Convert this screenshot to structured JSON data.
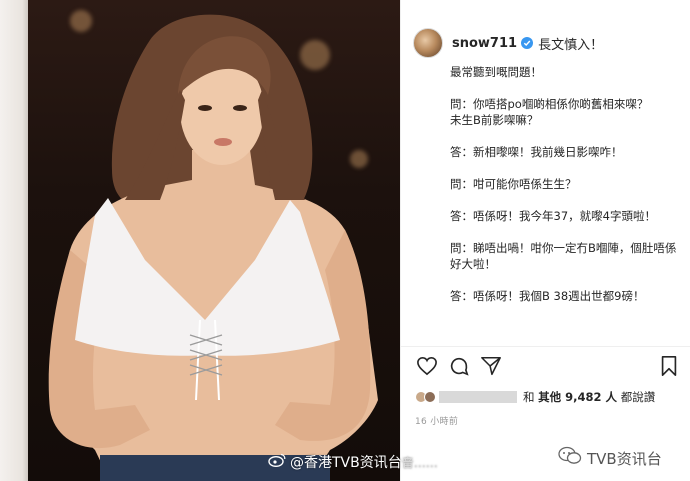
{
  "post": {
    "username": "snow711",
    "header_caption": "長文慎入！",
    "caption_lines": [
      "最常聽到嘅問題！",
      "",
      "問：你唔搭po嗰啲相係你啲舊相來㗎？",
      "未生B前影㗎嘛？",
      "",
      "答：新相嚟㗎！我前幾日影㗎咋！",
      "",
      "問：咁可能你唔係生生？",
      "",
      "答：唔係呀！我今年37，就嚟4字頭啦！",
      "",
      "問：睇唔出喎！咁你一定冇B嗰陣，個肚唔係好大啦！",
      "",
      "答：唔係呀！我個B 38週出世都9磅！"
    ],
    "likes_text": "和",
    "likes_count": "其他 9,482 人",
    "likes_suffix": "都說讚",
    "timestamp": "16 小時前"
  },
  "icons": [
    "heart-icon",
    "comment-icon",
    "share-icon",
    "bookmark-icon",
    "verified-icon"
  ],
  "watermarks": {
    "weibo": "@香港TVB资讯台",
    "weibo_trailing": "音……",
    "wechat": "TVB资讯台"
  },
  "colors": {
    "verified": "#3897f0",
    "text": "#262626",
    "muted": "#999999"
  }
}
